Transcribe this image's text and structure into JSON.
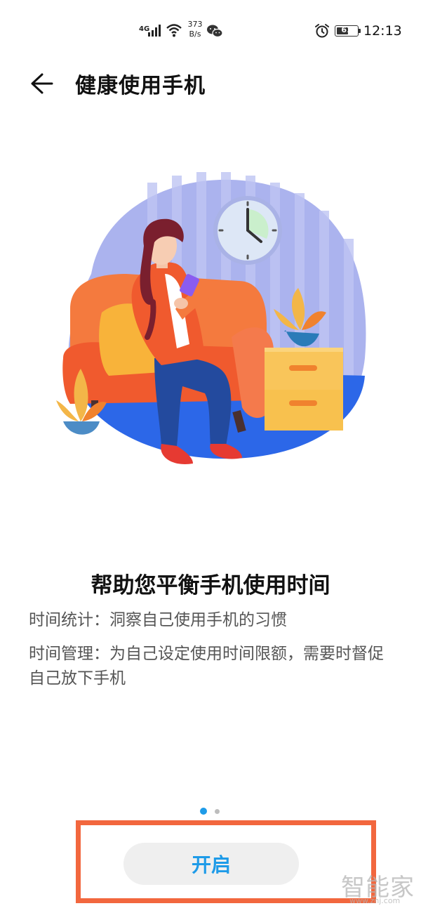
{
  "status_bar": {
    "network": "4G",
    "speed": "373\nB/s",
    "battery_level": "61",
    "time": "12:13"
  },
  "header": {
    "title": "健康使用手机"
  },
  "content": {
    "headline": "帮助您平衡手机使用时间",
    "description_1": "时间统计：洞察自己使用手机的习惯",
    "description_2": "时间管理：为自己设定使用时间限额，需要时督促自己放下手机"
  },
  "pager": {
    "total": 2,
    "active": 1
  },
  "action": {
    "start_label": "开启"
  },
  "watermark": {
    "text": "智能家",
    "url": "www.znj.com"
  },
  "colors": {
    "accent": "#1E9BE8",
    "highlight_border": "#F2673E",
    "button_bg": "#EFEFEF"
  }
}
